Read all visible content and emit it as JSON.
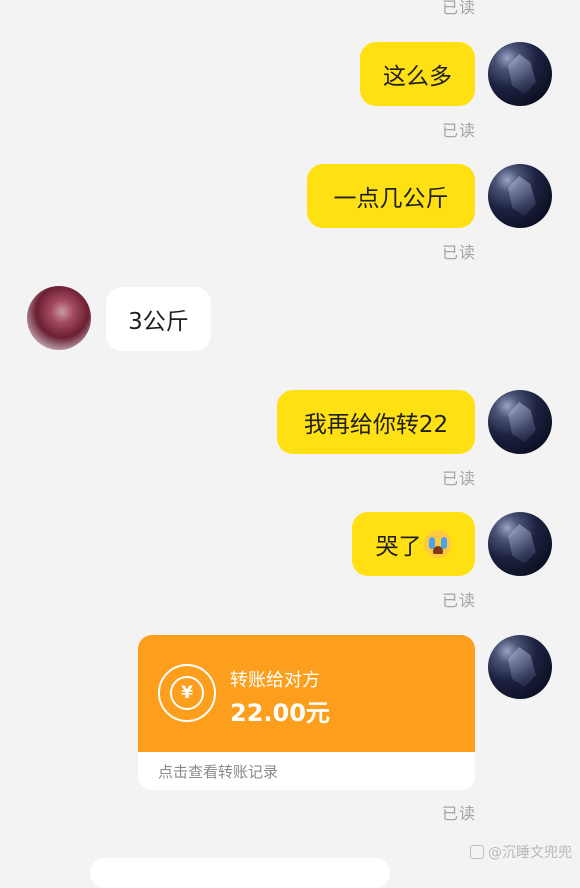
{
  "read_label": "已读",
  "messages": [
    {
      "text": "这么多"
    },
    {
      "text": "一点几公斤"
    },
    {
      "text": "3公斤"
    },
    {
      "text": "我再给你转22"
    },
    {
      "text": "哭了",
      "emoji": "crying-face"
    }
  ],
  "transfer": {
    "title": "转账给对方",
    "amount": "22.00元",
    "footer": "点击查看转账记录",
    "currency_symbol": "¥",
    "color": "#fd9e1c"
  },
  "watermark": "@沉睡文兜兜",
  "colors": {
    "my_bubble": "#ffe012",
    "their_bubble": "#ffffff",
    "background": "#f3f3f3"
  }
}
